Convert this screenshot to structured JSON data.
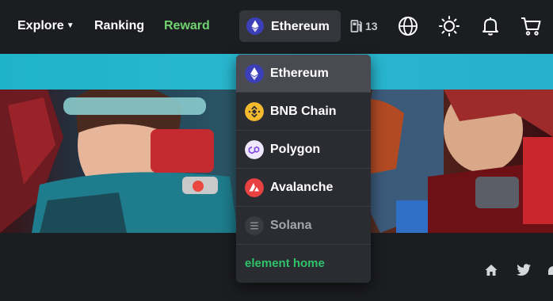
{
  "nav": {
    "explore": "Explore",
    "ranking": "Ranking",
    "reward": "Reward",
    "chain_selected": "Ethereum",
    "gas_value": "13",
    "icons": [
      "globe-icon",
      "sun-icon",
      "bell-icon",
      "cart-icon"
    ]
  },
  "chains": [
    {
      "label": "Ethereum",
      "icon": "ethereum-icon",
      "color": "#3b3fb8",
      "selected": true
    },
    {
      "label": "BNB Chain",
      "icon": "bnb-icon",
      "color": "#f3ba2f",
      "selected": false
    },
    {
      "label": "Polygon",
      "icon": "polygon-icon",
      "color": "#8247e5",
      "selected": false
    },
    {
      "label": "Avalanche",
      "icon": "avalanche-icon",
      "color": "#e84142",
      "selected": false
    },
    {
      "label": "Solana",
      "icon": "solana-icon",
      "color": "#3a3b40",
      "selected": false
    }
  ],
  "dropdown_link": "element home",
  "colors": {
    "background": "#1c1d21",
    "reward": "#6fd36f",
    "link": "#2fc26a",
    "banner_strip": "#1fb3c9"
  },
  "footer_icons": [
    "home-icon",
    "twitter-icon"
  ]
}
